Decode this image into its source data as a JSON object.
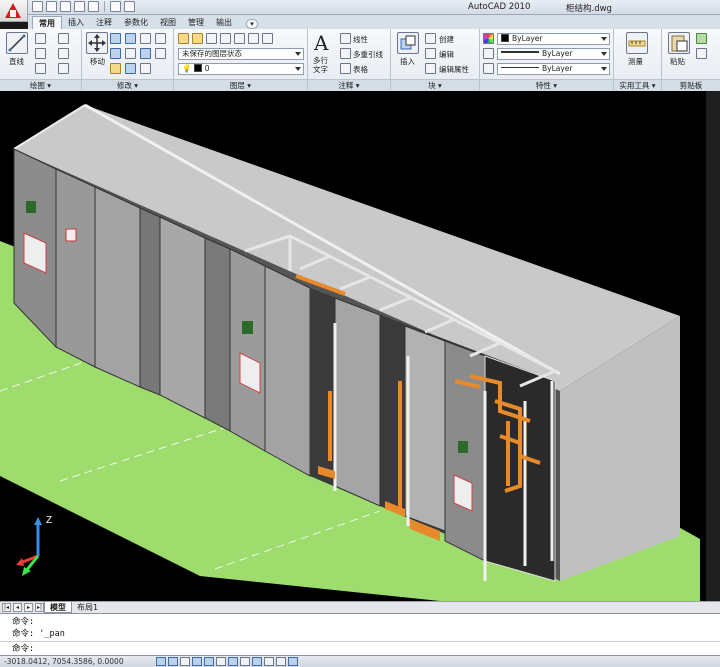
{
  "window": {
    "app_title": "AutoCAD 2010",
    "file_name": "柜结构.dwg"
  },
  "ribbon": {
    "tabs": [
      "常用",
      "插入",
      "注释",
      "参数化",
      "视图",
      "管理",
      "输出"
    ],
    "active_tab": "常用",
    "panels": {
      "draw": {
        "title": "绘图",
        "line_label": "直线"
      },
      "modify": {
        "title": "修改",
        "move_label": "移动"
      },
      "layers": {
        "title": "图层",
        "layer_state": "未保存的图层状态",
        "current_layer": "0"
      },
      "annotation": {
        "title": "注释",
        "mtext_label": "多行\n文字",
        "linear_label": "线性",
        "mleader_label": "多重引线",
        "table_label": "表格"
      },
      "block": {
        "title": "块",
        "insert_label": "插入",
        "create_label": "创建",
        "edit_label": "编辑",
        "edit_attr_label": "编辑属性"
      },
      "properties": {
        "title": "特性",
        "color": "ByLayer",
        "linetype": "ByLayer",
        "lineweight": "ByLayer"
      },
      "utilities": {
        "title": "实用工具",
        "measure_label": "测量"
      },
      "clipboard": {
        "title": "剪贴板",
        "paste_label": "粘贴"
      }
    }
  },
  "viewport": {
    "ucs_z_label": "Z",
    "colors": {
      "background": "#000000",
      "ground": "#9fdc6e",
      "roof": "#c8c8c8",
      "cabinet": "#a9a9a9",
      "frame": "#e6e6e6",
      "copper": "#e8892a",
      "module_blue": "#2a2fd6"
    }
  },
  "layout_tabs": [
    "模型",
    "布局1"
  ],
  "active_layout_tab": "模型",
  "command_line": {
    "history_1": "命令:",
    "history_2": "命令: '_pan",
    "prompt": "命令:"
  },
  "status": {
    "coordinates": "-3018.0412, 7054.3586, 0.0000"
  }
}
